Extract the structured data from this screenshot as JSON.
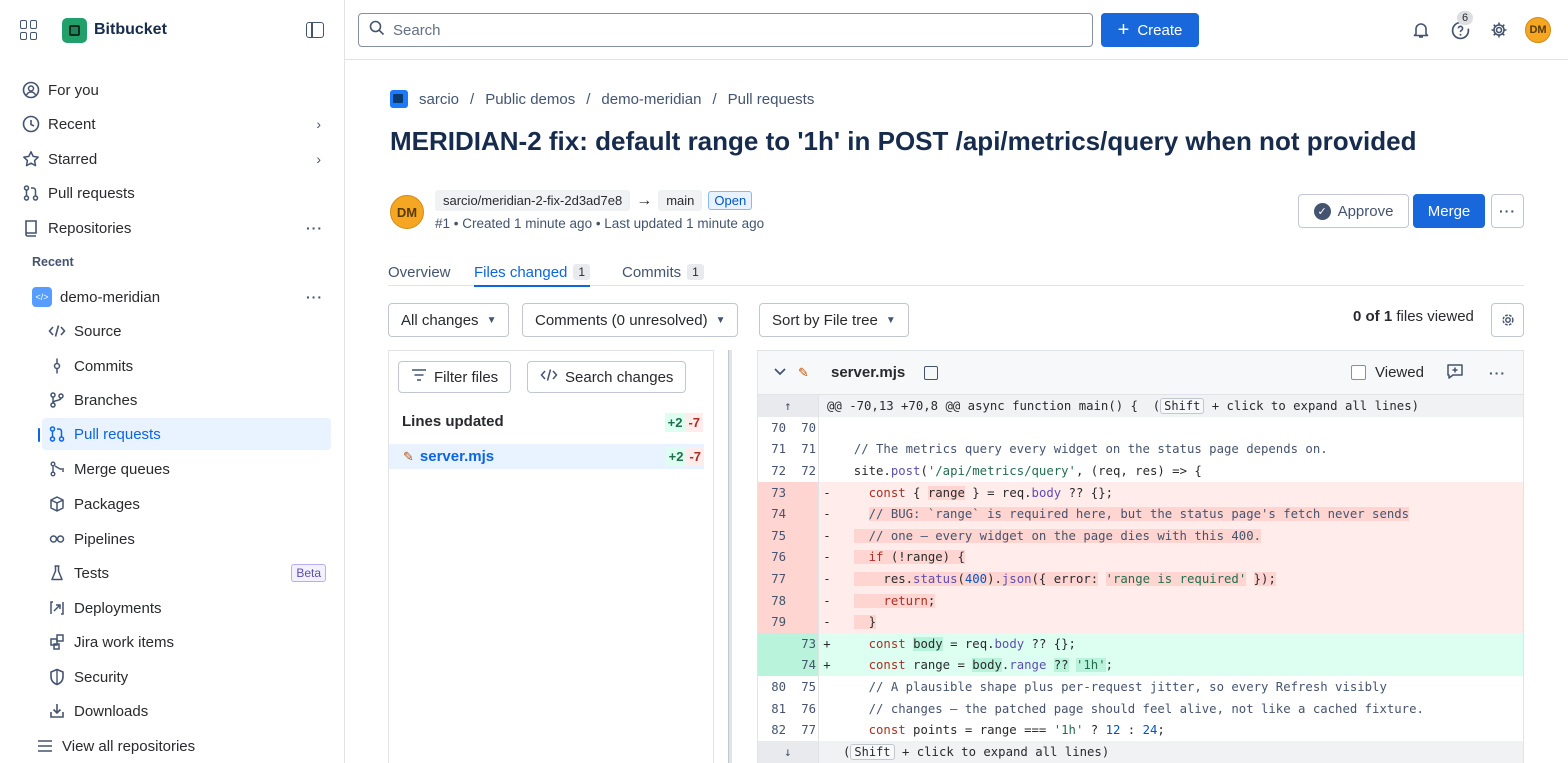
{
  "sidebar": {
    "brand": "Bitbucket",
    "items": [
      {
        "label": "For you",
        "icon": "user-circle-icon"
      },
      {
        "label": "Recent",
        "icon": "clock-icon"
      },
      {
        "label": "Starred",
        "icon": "star-icon"
      },
      {
        "label": "Pull requests",
        "icon": "pull-request-icon"
      },
      {
        "label": "Repositories",
        "icon": "repository-icon"
      }
    ],
    "section_recent": "Recent",
    "repo": {
      "name": "demo-meridian",
      "badge": "</>"
    },
    "repo_items": [
      {
        "label": "Source",
        "icon": "code-icon"
      },
      {
        "label": "Commits",
        "icon": "commit-icon"
      },
      {
        "label": "Branches",
        "icon": "branch-icon"
      },
      {
        "label": "Pull requests",
        "icon": "pull-request-icon"
      },
      {
        "label": "Merge queues",
        "icon": "merge-queue-icon"
      },
      {
        "label": "Packages",
        "icon": "package-icon"
      },
      {
        "label": "Pipelines",
        "icon": "pipeline-icon"
      },
      {
        "label": "Tests",
        "icon": "beaker-icon",
        "badge": "Beta"
      },
      {
        "label": "Deployments",
        "icon": "deployment-icon"
      },
      {
        "label": "Jira work items",
        "icon": "jira-icon"
      },
      {
        "label": "Security",
        "icon": "shield-icon"
      },
      {
        "label": "Downloads",
        "icon": "download-icon"
      }
    ],
    "view_all": "View all repositories"
  },
  "topbar": {
    "search_placeholder": "Search",
    "create_label": "Create",
    "help_count": "6",
    "avatar_initials": "DM"
  },
  "breadcrumb": [
    "sarcio",
    "Public demos",
    "demo-meridian",
    "Pull requests"
  ],
  "pr": {
    "title": "MERIDIAN-2 fix: default range to '1h' in POST /api/metrics/query when not provided",
    "author_initials": "DM",
    "source_branch": "sarcio/meridian-2-fix-2d3ad7e8",
    "target_branch": "main",
    "status": "Open",
    "meta": "#1 • Created 1 minute ago • Last updated 1 minute ago",
    "approve_label": "Approve",
    "merge_label": "Merge"
  },
  "tabs": [
    {
      "label": "Overview",
      "count": ""
    },
    {
      "label": "Files changed",
      "count": "1"
    },
    {
      "label": "Commits",
      "count": "1"
    }
  ],
  "filters": {
    "all_changes": "All changes",
    "comments": "Comments (0 unresolved)",
    "sort": "Sort by File tree",
    "viewed_count": "0 of 1",
    "viewed_suffix": " files viewed"
  },
  "filetree": {
    "filter_label": "Filter files",
    "search_label": "Search changes",
    "lines_updated": "Lines updated",
    "added": "+2",
    "removed": "-7",
    "file": "server.mjs"
  },
  "diff": {
    "filename": "server.mjs",
    "viewed_label": "Viewed",
    "hunk_header": "@@ -70,13 +70,8 @@ async function main() {",
    "expand_hint": "+ click to expand all lines)",
    "shift_key": "Shift"
  }
}
